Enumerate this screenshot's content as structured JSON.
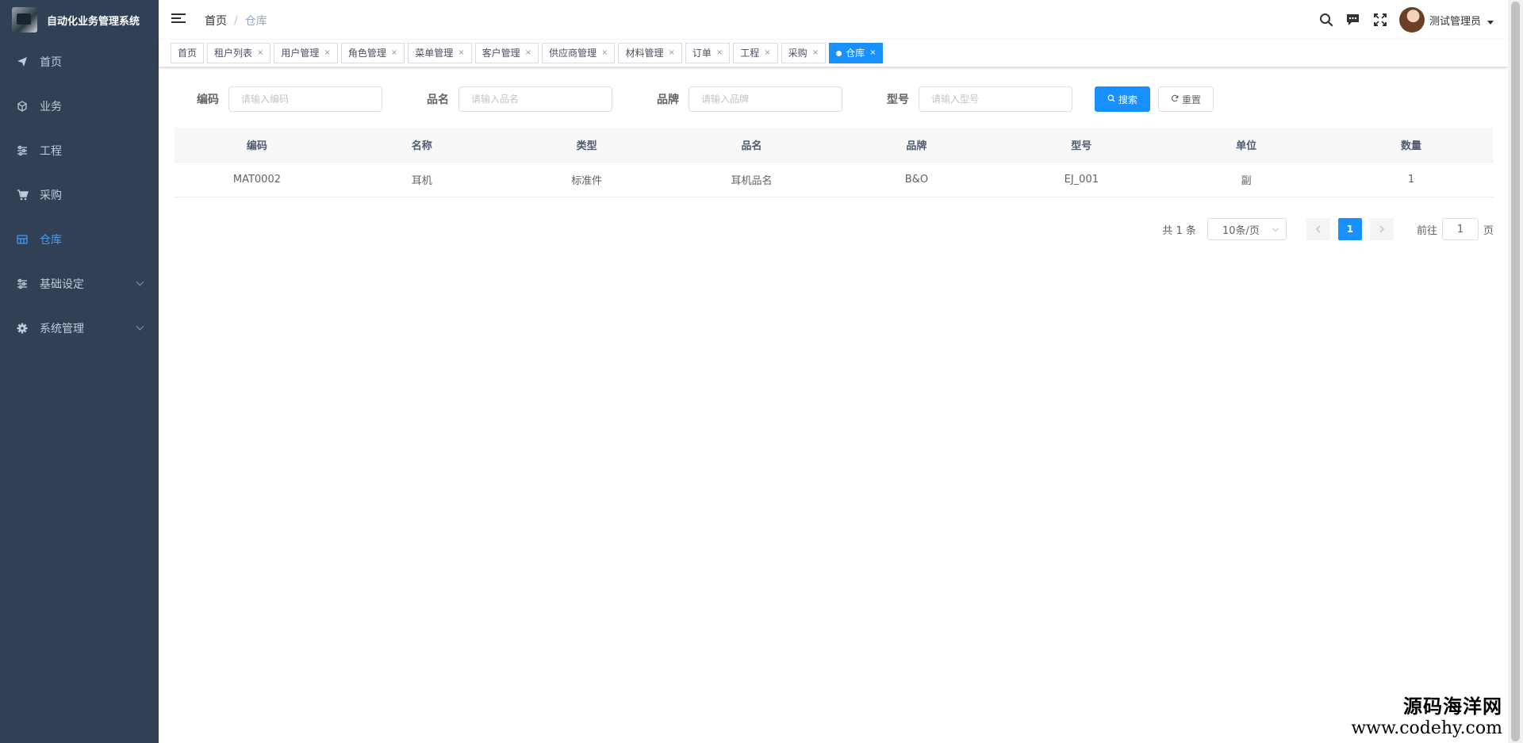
{
  "app": {
    "title": "自动化业务管理系统"
  },
  "sidebar": {
    "items": [
      {
        "label": "首页",
        "icon": "paper-plane-icon"
      },
      {
        "label": "业务",
        "icon": "cube-icon"
      },
      {
        "label": "工程",
        "icon": "sliders-icon"
      },
      {
        "label": "采购",
        "icon": "cart-icon"
      },
      {
        "label": "仓库",
        "icon": "warehouse-icon",
        "active": true
      },
      {
        "label": "基础设定",
        "icon": "sliders-icon",
        "has_children": true
      },
      {
        "label": "系统管理",
        "icon": "gear-icon",
        "has_children": true
      }
    ]
  },
  "navbar": {
    "breadcrumb": {
      "home": "首页",
      "separator": "/",
      "current": "仓库"
    },
    "icons": [
      "search-icon",
      "message-icon",
      "fullscreen-icon"
    ],
    "user": {
      "name": "测试管理员"
    }
  },
  "tags": [
    {
      "label": "首页",
      "closable": false
    },
    {
      "label": "租户列表",
      "closable": true
    },
    {
      "label": "用户管理",
      "closable": true
    },
    {
      "label": "角色管理",
      "closable": true
    },
    {
      "label": "菜单管理",
      "closable": true
    },
    {
      "label": "客户管理",
      "closable": true
    },
    {
      "label": "供应商管理",
      "closable": true
    },
    {
      "label": "材料管理",
      "closable": true
    },
    {
      "label": "订单",
      "closable": true
    },
    {
      "label": "工程",
      "closable": true
    },
    {
      "label": "采购",
      "closable": true
    },
    {
      "label": "仓库",
      "closable": true,
      "active": true
    }
  ],
  "tag_close_glyph": "×",
  "search": {
    "fields": [
      {
        "label": "编码",
        "placeholder": "请输入编码",
        "value": ""
      },
      {
        "label": "品名",
        "placeholder": "请输入品名",
        "value": ""
      },
      {
        "label": "品牌",
        "placeholder": "请输入品牌",
        "value": ""
      },
      {
        "label": "型号",
        "placeholder": "请输入型号",
        "value": ""
      }
    ],
    "search_button": "搜索",
    "reset_button": "重置"
  },
  "table": {
    "columns": [
      "编码",
      "名称",
      "类型",
      "品名",
      "品牌",
      "型号",
      "单位",
      "数量"
    ],
    "rows": [
      [
        "MAT0002",
        "耳机",
        "标准件",
        "耳机品名",
        "B&O",
        "EJ_001",
        "副",
        "1"
      ]
    ]
  },
  "pagination": {
    "total_text": "共 1 条",
    "page_size": "10条/页",
    "current_page": "1",
    "goto_prefix": "前往",
    "goto_value": "1",
    "goto_suffix": "页"
  },
  "watermark": {
    "line1": "源码海洋网",
    "line2": "www.codehy.com"
  },
  "colors": {
    "sidebar_bg": "#304156",
    "accent": "#1890ff",
    "menu_active": "#409eff"
  }
}
